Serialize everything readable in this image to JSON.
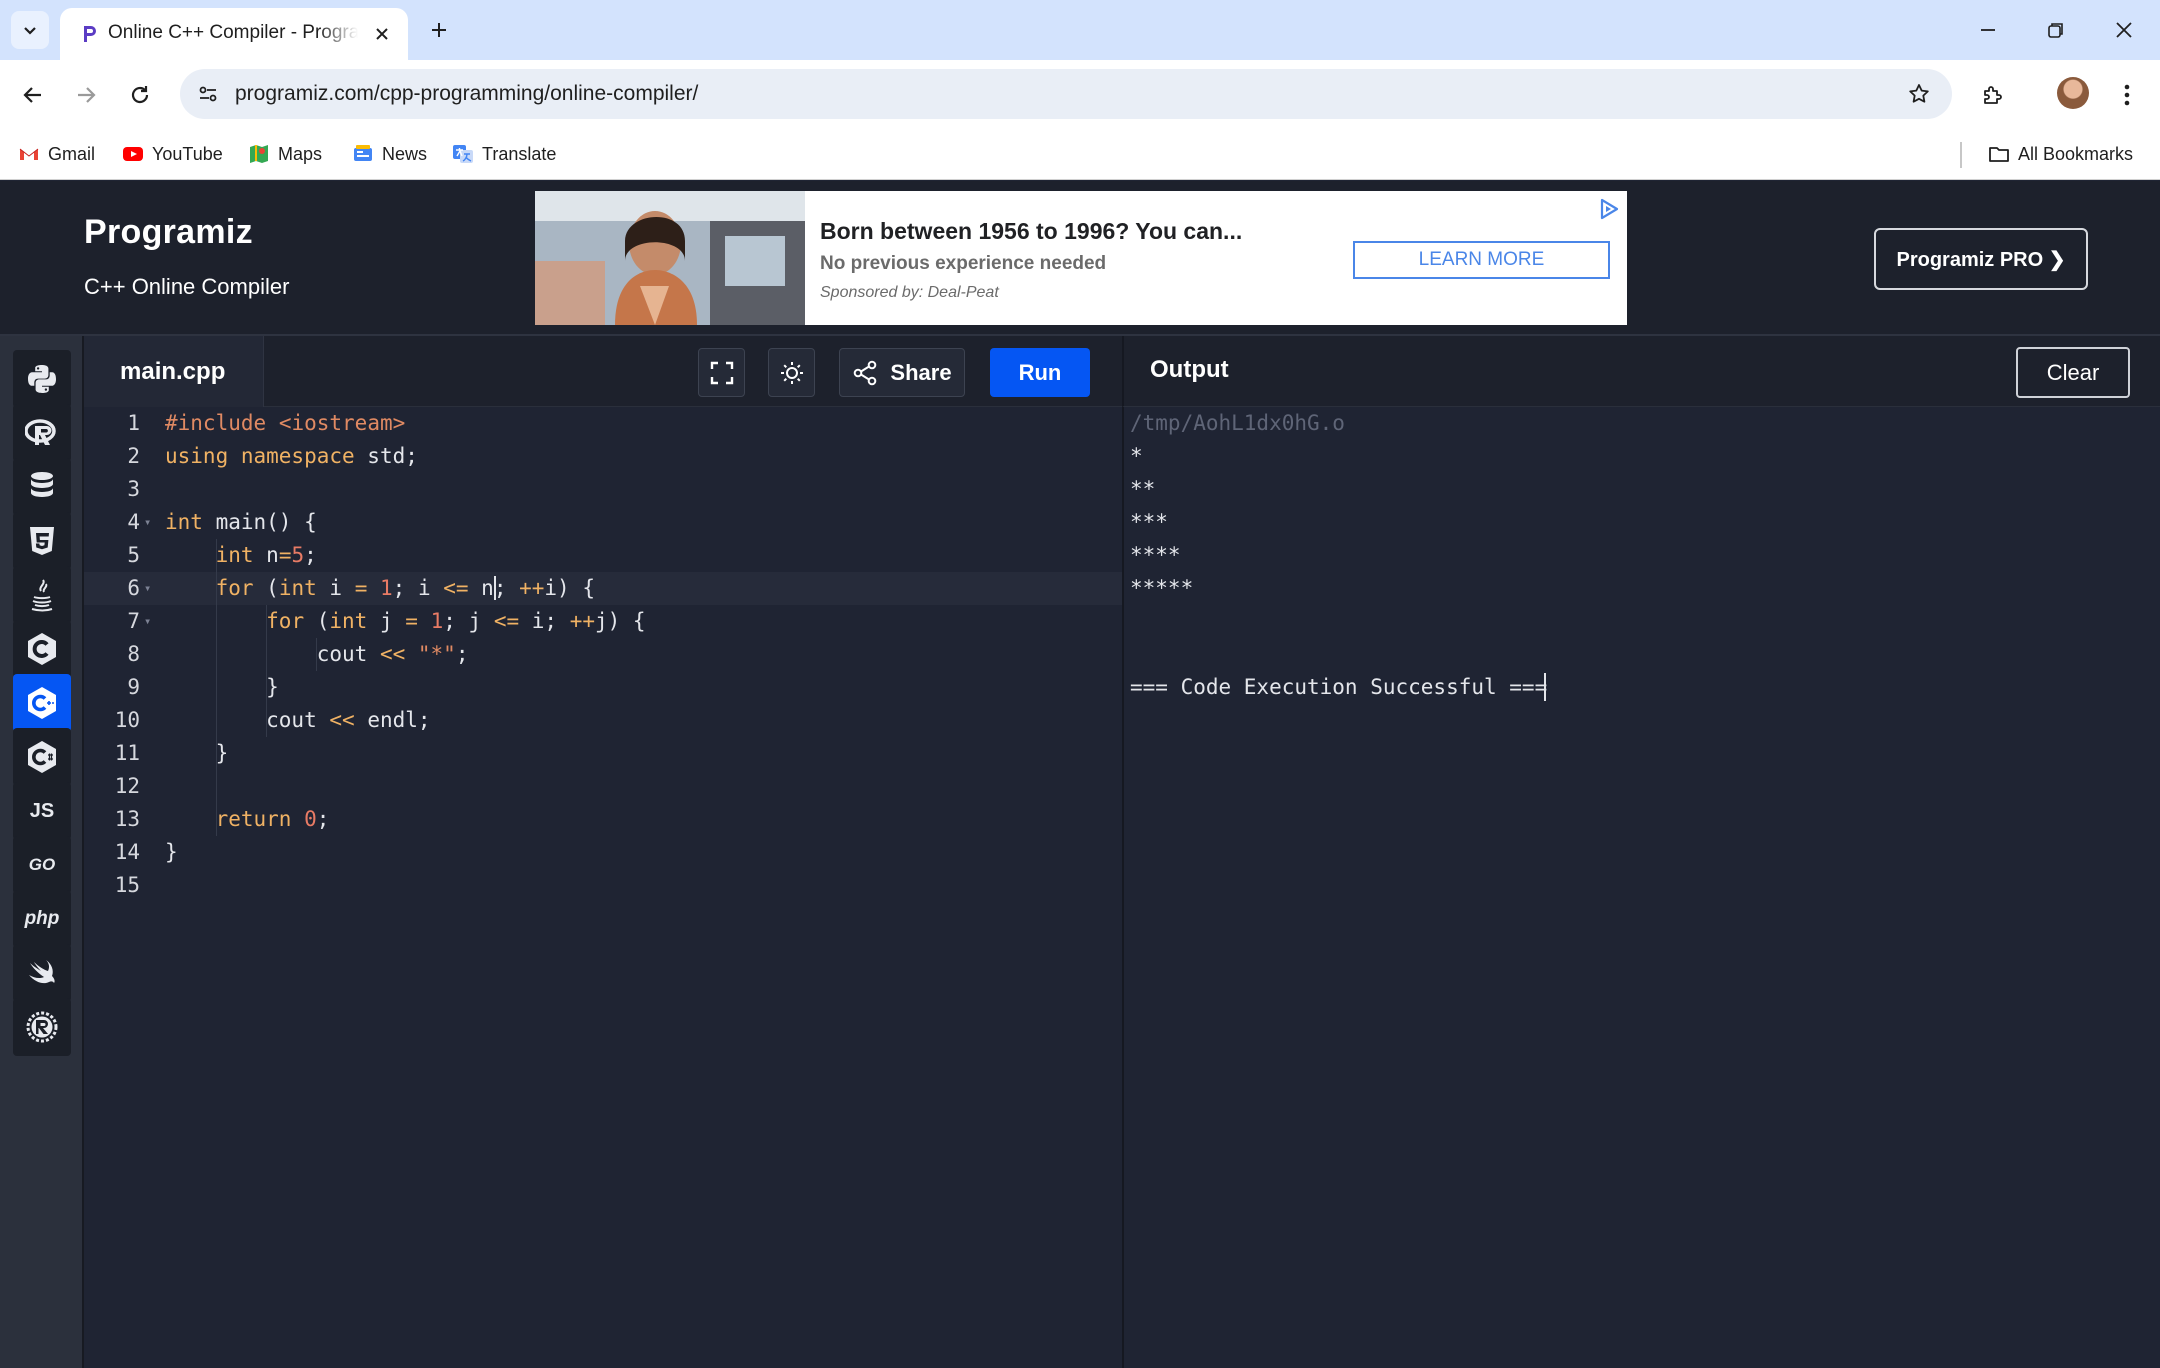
{
  "browser": {
    "tab_title": "Online C++ Compiler - Programiz",
    "url": "programiz.com/cpp-programming/online-compiler/",
    "bookmarks": [
      {
        "label": "Gmail",
        "icon": "gmail-icon"
      },
      {
        "label": "YouTube",
        "icon": "youtube-icon"
      },
      {
        "label": "Maps",
        "icon": "maps-icon"
      },
      {
        "label": "News",
        "icon": "news-icon"
      },
      {
        "label": "Translate",
        "icon": "translate-icon"
      }
    ],
    "all_bookmarks": "All Bookmarks"
  },
  "header": {
    "logo": "Programiz",
    "subtitle": "C++ Online Compiler",
    "pro_button": "Programiz PRO ❯"
  },
  "ad": {
    "title": "Born between 1956 to 1996? You can...",
    "description": "No previous experience needed",
    "sponsor": "Sponsored by: Deal-Peat",
    "cta": "LEARN MORE"
  },
  "sidebar": {
    "languages": [
      {
        "name": "python",
        "icon": "python-icon"
      },
      {
        "name": "r",
        "icon": "r-icon"
      },
      {
        "name": "sql",
        "icon": "database-icon"
      },
      {
        "name": "html",
        "icon": "html5-icon"
      },
      {
        "name": "java",
        "icon": "java-icon"
      },
      {
        "name": "c",
        "icon": "c-icon"
      },
      {
        "name": "cpp",
        "icon": "cpp-icon",
        "active": true
      },
      {
        "name": "csharp",
        "icon": "csharp-icon"
      },
      {
        "name": "javascript",
        "icon": "js-icon",
        "label": "JS"
      },
      {
        "name": "go",
        "icon": "go-icon",
        "label": "GO"
      },
      {
        "name": "php",
        "icon": "php-icon",
        "label": "php"
      },
      {
        "name": "swift",
        "icon": "swift-icon"
      },
      {
        "name": "rust",
        "icon": "rust-icon"
      }
    ]
  },
  "editor": {
    "file_name": "main.cpp",
    "share_label": "Share",
    "run_label": "Run",
    "active_line": 6,
    "lines": [
      "#include <iostream>",
      "using namespace std;",
      "",
      "int main() {",
      "    int n=5;",
      "    for (int i = 1; i <= n; ++i) {",
      "        for (int j = 1; j <= i; ++j) {",
      "            cout << \"*\";",
      "        }",
      "        cout << endl;",
      "    }",
      "",
      "    return 0;",
      "}",
      ""
    ]
  },
  "output": {
    "title": "Output",
    "clear_label": "Clear",
    "lines": [
      "/tmp/AohL1dx0hG.o",
      "*",
      "**",
      "***",
      "****",
      "*****",
      "",
      "",
      "=== Code Execution Successful ==="
    ]
  },
  "colors": {
    "accent": "#0556f3",
    "background": "#1f2433",
    "header": "#1d212c"
  }
}
